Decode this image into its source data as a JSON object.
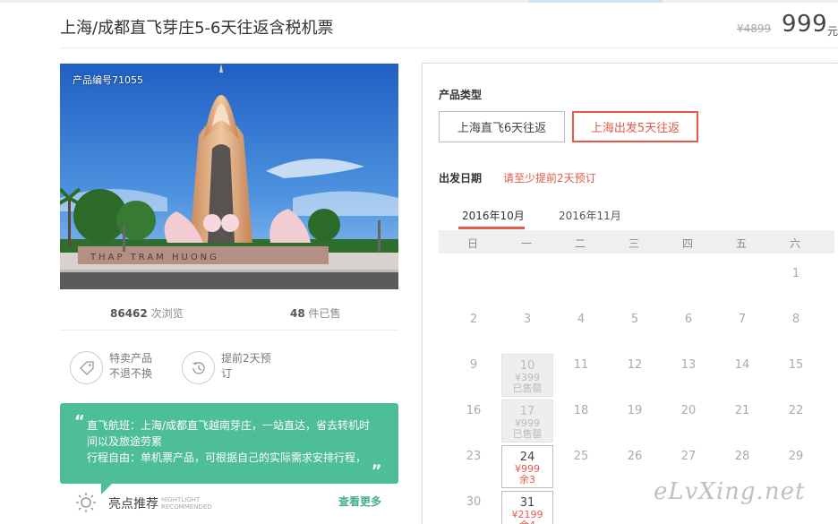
{
  "header": {
    "title": "上海/成都直飞芽庄5-6天往返含税机票",
    "old_price": "¥4899",
    "price": "999",
    "price_unit": "元"
  },
  "photo": {
    "product_code": "产品编号71055",
    "sign_text": "THAP TRAM HUONG"
  },
  "stats": {
    "views_num": "86462",
    "views_label": "次浏览",
    "sold_num": "48",
    "sold_label": "件已售"
  },
  "features": [
    {
      "line1": "特卖产品",
      "line2": "不退不换",
      "icon": "tag-icon"
    },
    {
      "line1": "提前2天预",
      "line2": "订",
      "icon": "clock-icon"
    }
  ],
  "highlight": {
    "line1": "直飞航班：上海/成都直飞越南芽庄，一站直达，省去转机时",
    "line2": "间以及旅途劳累",
    "line3": "行程自由：单机票产品，可根据自己的实际需求安排行程，"
  },
  "recommend": {
    "label": "亮点推荐",
    "eng1": "HIGHTLIGHT",
    "eng2": "RECOMMENDED",
    "more": "查看更多"
  },
  "booking": {
    "type_label": "产品类型",
    "types": [
      "上海直飞6天往返",
      "上海出发5天往返"
    ],
    "date_label": "出发日期",
    "date_hint": "请至少提前2天预订",
    "months": [
      "2016年10月",
      "2016年11月"
    ],
    "weekdays": [
      "日",
      "一",
      "二",
      "三",
      "四",
      "五",
      "六"
    ],
    "days": [
      {
        "n": "1",
        "col": 6,
        "row": 0
      },
      {
        "n": "2",
        "col": 0,
        "row": 1
      },
      {
        "n": "3",
        "col": 1,
        "row": 1
      },
      {
        "n": "4",
        "col": 2,
        "row": 1
      },
      {
        "n": "5",
        "col": 3,
        "row": 1
      },
      {
        "n": "6",
        "col": 4,
        "row": 1
      },
      {
        "n": "7",
        "col": 5,
        "row": 1
      },
      {
        "n": "8",
        "col": 6,
        "row": 1
      },
      {
        "n": "9",
        "col": 0,
        "row": 2
      },
      {
        "n": "10",
        "col": 1,
        "row": 2,
        "state": "sold",
        "price": "¥399",
        "note": "已售罄"
      },
      {
        "n": "11",
        "col": 2,
        "row": 2
      },
      {
        "n": "12",
        "col": 3,
        "row": 2
      },
      {
        "n": "13",
        "col": 4,
        "row": 2
      },
      {
        "n": "14",
        "col": 5,
        "row": 2
      },
      {
        "n": "15",
        "col": 6,
        "row": 2
      },
      {
        "n": "16",
        "col": 0,
        "row": 3
      },
      {
        "n": "17",
        "col": 1,
        "row": 3,
        "state": "sold",
        "price": "¥999",
        "note": "已售罄"
      },
      {
        "n": "18",
        "col": 2,
        "row": 3
      },
      {
        "n": "19",
        "col": 3,
        "row": 3
      },
      {
        "n": "20",
        "col": 4,
        "row": 3
      },
      {
        "n": "21",
        "col": 5,
        "row": 3
      },
      {
        "n": "22",
        "col": 6,
        "row": 3
      },
      {
        "n": "23",
        "col": 0,
        "row": 4
      },
      {
        "n": "24",
        "col": 1,
        "row": 4,
        "state": "avail",
        "price": "¥999",
        "note": "余3"
      },
      {
        "n": "25",
        "col": 2,
        "row": 4
      },
      {
        "n": "26",
        "col": 3,
        "row": 4
      },
      {
        "n": "27",
        "col": 4,
        "row": 4
      },
      {
        "n": "28",
        "col": 5,
        "row": 4
      },
      {
        "n": "29",
        "col": 6,
        "row": 4
      },
      {
        "n": "30",
        "col": 0,
        "row": 5
      },
      {
        "n": "31",
        "col": 1,
        "row": 5,
        "state": "avail",
        "price": "¥2199",
        "note": "余4"
      }
    ]
  },
  "watermark": "eLvXing.net"
}
